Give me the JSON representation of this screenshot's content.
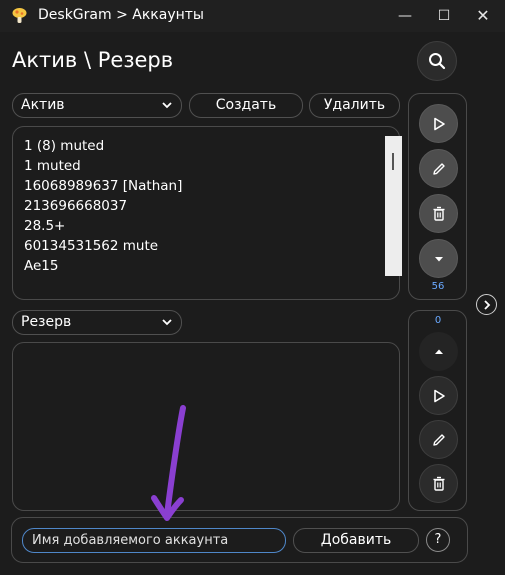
{
  "window": {
    "title": "DeskGram > Аккаунты",
    "minimize_glyph": "—",
    "maximize_glyph": "☐",
    "close_glyph": "✕"
  },
  "page": {
    "title": "Актив \\ Резерв"
  },
  "active": {
    "dropdown_value": "Актив",
    "create_label": "Создать",
    "delete_label": "Удалить",
    "accounts": [
      "1 (8) muted",
      "1 muted",
      "16068989637 [Nathan]",
      "213696668037",
      "28.5+",
      "60134531562 mute",
      "Ae15"
    ],
    "count": "56"
  },
  "reserve": {
    "dropdown_value": "Резерв",
    "accounts": [],
    "count": "0"
  },
  "add": {
    "placeholder": "Имя добавляемого аккаунта",
    "add_label": "Добавить",
    "help_label": "?"
  },
  "icons": [
    "app-icon",
    "search-icon",
    "play-icon",
    "pencil-icon",
    "trash-icon",
    "arrow-down-icon",
    "arrow-up-icon",
    "chevron-down-icon",
    "chevron-right-icon"
  ],
  "colors": {
    "background": "#1c1c1c",
    "accent_count": "#6aa9ff",
    "input_border": "#4f87c9",
    "annotation": "#8a3fd1"
  }
}
